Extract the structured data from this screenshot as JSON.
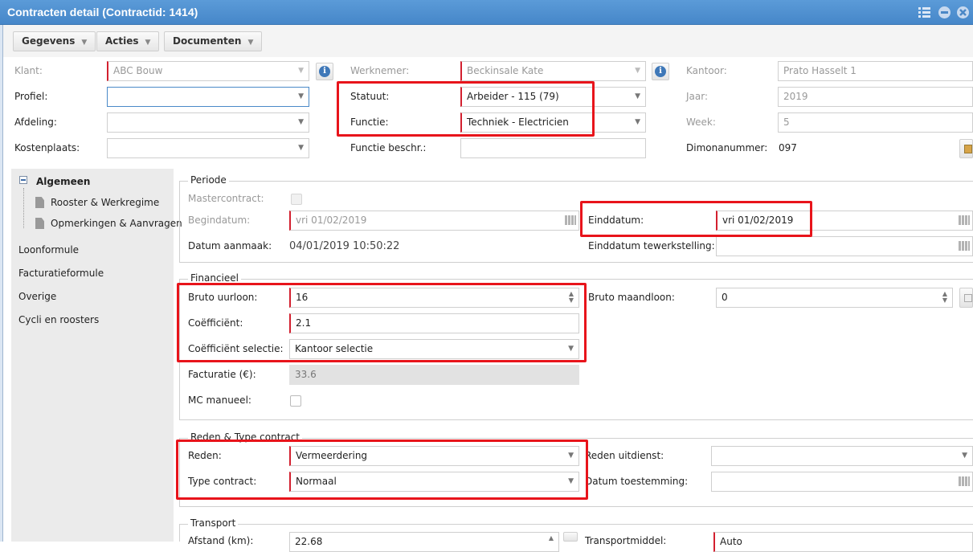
{
  "window": {
    "title": "Contracten detail (Contractid: 1414)",
    "controls": [
      "grid-icon",
      "minimize-icon",
      "close-icon"
    ]
  },
  "toolbar": {
    "gegevens": "Gegevens",
    "acties": "Acties",
    "documenten": "Documenten"
  },
  "header": {
    "klant_label": "Klant:",
    "klant_value": "ABC Bouw",
    "profiel_label": "Profiel:",
    "profiel_value": "",
    "afdeling_label": "Afdeling:",
    "afdeling_value": "",
    "kostenplaats_label": "Kostenplaats:",
    "kostenplaats_value": "",
    "werknemer_label": "Werknemer:",
    "werknemer_value": "Beckinsale Kate",
    "statuut_label": "Statuut:",
    "statuut_value": "Arbeider - 115 (79)",
    "functie_label": "Functie:",
    "functie_value": "Techniek - Electricien",
    "functie_beschr_label": "Functie beschr.:",
    "functie_beschr_value": "",
    "kantoor_label": "Kantoor:",
    "kantoor_value": "Prato Hasselt 1",
    "jaar_label": "Jaar:",
    "jaar_value": "2019",
    "week_label": "Week:",
    "week_value": "5",
    "dimona_label": "Dimonanummer:",
    "dimona_value": "097"
  },
  "sidebar": {
    "group_label": "Algemeen",
    "subitems": [
      "Rooster & Werkregime",
      "Opmerkingen & Aanvragen"
    ],
    "items": [
      "Loonformule",
      "Facturatieformule",
      "Overige",
      "Cycli en roosters"
    ]
  },
  "periode": {
    "legend": "Periode",
    "mastercontract_label": "Mastercontract:",
    "begindatum_label": "Begindatum:",
    "begindatum_value": "vri 01/02/2019",
    "datum_aanmaak_label": "Datum aanmaak:",
    "datum_aanmaak_value": "04/01/2019 10:50:22",
    "einddatum_label": "Einddatum:",
    "einddatum_value": "vri 01/02/2019",
    "einddatum_tewerk_label": "Einddatum tewerkstelling:",
    "einddatum_tewerk_value": ""
  },
  "financieel": {
    "legend": "Financieel",
    "bruto_uurloon_label": "Bruto uurloon:",
    "bruto_uurloon_value": "16",
    "coefficient_label": "Coëfficiënt:",
    "coefficient_value": "2.1",
    "coefficient_selectie_label": "Coëfficiënt selectie:",
    "coefficient_selectie_value": "Kantoor selectie",
    "facturatie_label": "Facturatie (€):",
    "facturatie_value": "33.6",
    "mc_manueel_label": "MC manueel:",
    "bruto_maandloon_label": "Bruto maandloon:",
    "bruto_maandloon_value": "0"
  },
  "reden": {
    "legend": "Reden & Type contract",
    "reden_label": "Reden:",
    "reden_value": "Vermeerdering",
    "type_contract_label": "Type contract:",
    "type_contract_value": "Normaal",
    "reden_uitdienst_label": "Reden uitdienst:",
    "reden_uitdienst_value": "",
    "datum_toestemming_label": "Datum toestemming:",
    "datum_toestemming_value": ""
  },
  "transport": {
    "legend": "Transport",
    "afstand_label": "Afstand (km):",
    "afstand_value": "22.68",
    "transportmiddel_label": "Transportmiddel:",
    "transportmiddel_value": "Auto"
  },
  "colors": {
    "titlebar": "#4a8ccd",
    "required_marker": "#d3202f",
    "highlight_box": "#e8141b"
  }
}
